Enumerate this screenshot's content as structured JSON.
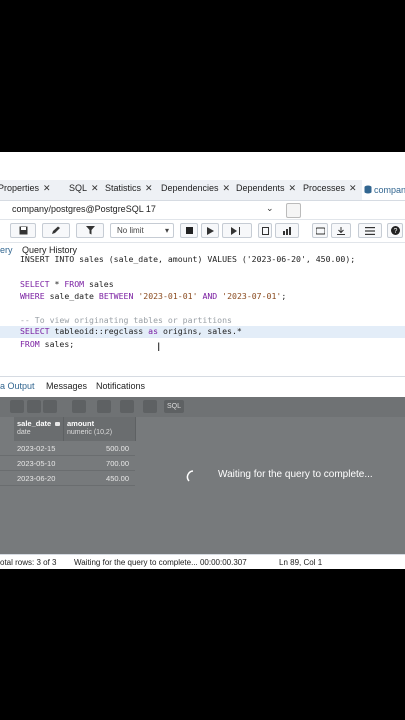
{
  "tabs": {
    "items": [
      {
        "label": "Properties",
        "close": "✕"
      },
      {
        "label": "SQL",
        "close": "✕"
      },
      {
        "label": "Statistics",
        "close": "✕"
      },
      {
        "label": "Dependencies",
        "close": "✕"
      },
      {
        "label": "Dependents",
        "close": "✕"
      },
      {
        "label": "Processes",
        "close": "✕"
      },
      {
        "label": "compan",
        "close": ""
      }
    ]
  },
  "connection": {
    "label": "company/postgres@PostgreSQL 17"
  },
  "toolbar": {
    "limit_label": "No limit"
  },
  "subtabs": {
    "query": "ery",
    "history": "Query History"
  },
  "editor": {
    "lines": [
      "INSERT INTO sales (sale_date, amount) VALUES ('2023-06-20', 450.00);",
      "",
      "SELECT * FROM sales",
      "WHERE sale_date BETWEEN '2023-01-01' AND '2023-07-01';",
      "",
      "-- To view originating tables or partitions",
      "SELECT tableoid::regclass as origins, sales.*",
      "FROM sales;"
    ]
  },
  "results_tabs": {
    "data_output": "a Output",
    "messages": "Messages",
    "notifications": "Notifications"
  },
  "results_toolbar": {
    "sql_label": "SQL"
  },
  "grid": {
    "columns": [
      {
        "name": "sale_date",
        "type": "date"
      },
      {
        "name": "amount",
        "type": "numeric (10,2)"
      }
    ],
    "rows": [
      [
        "2023-02-15",
        "500.00"
      ],
      [
        "2023-05-10",
        "700.00"
      ],
      [
        "2023-06-20",
        "450.00"
      ]
    ]
  },
  "overlay": {
    "message": "Waiting for the query to complete..."
  },
  "status": {
    "total_rows": "otal rows: 3 of 3",
    "query_status": "Waiting for the query to complete... 00:00:00.307",
    "cursor_pos": "Ln 89, Col 1"
  },
  "colors": {
    "accent": "#326690",
    "highlight": "#e3edf8"
  }
}
